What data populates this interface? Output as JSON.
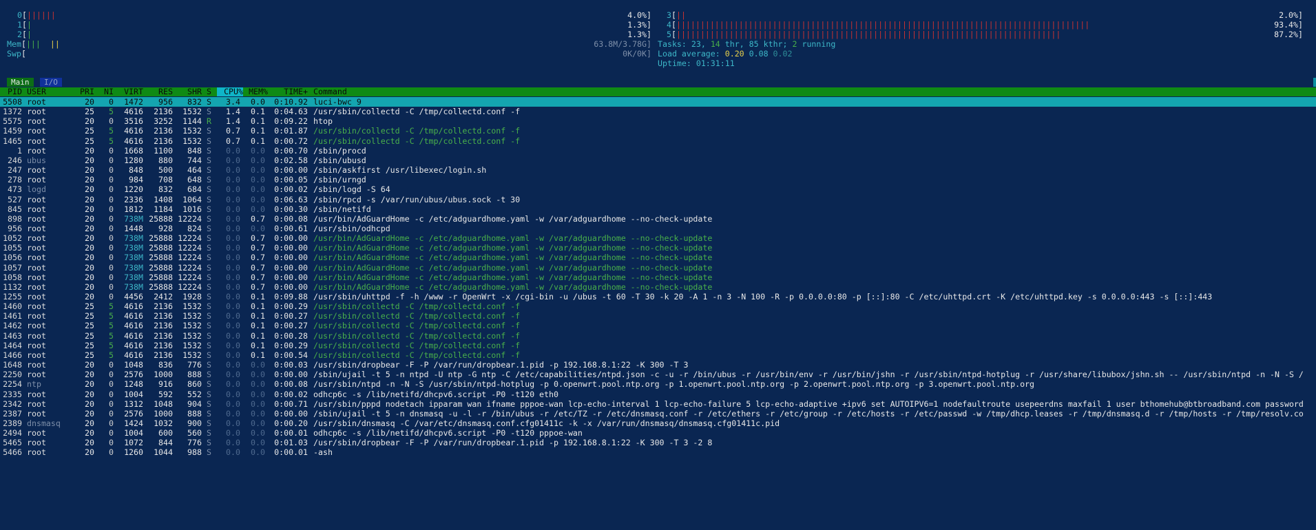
{
  "meters": {
    "cpu0": {
      "label": "0",
      "bars": "||||||",
      "pct": "4.0%]"
    },
    "cpu1": {
      "label": "1",
      "bars": "|",
      "pct": "1.3%]"
    },
    "cpu2": {
      "label": "2",
      "bars": "|",
      "pct": "1.3%]"
    },
    "cpu3": {
      "label": "3",
      "bars": "||",
      "pct": "2.0%]"
    },
    "cpu4": {
      "label": "4",
      "bars": "||||||||||||||||||||||||||||||||||||||||||||||||||||||||||||||||||||||||||||||||||||||",
      "pct": "93.4%]"
    },
    "cpu5": {
      "label": "5",
      "bars": "||||||||||||||||||||||||||||||||||||||||||||||||||||||||||||||||||||||||||||||||",
      "pct": "87.2%]"
    },
    "mem": {
      "label": "Mem",
      "bars": "|||",
      "bars2": "||",
      "value": "63.8M/3.78G]"
    },
    "swp": {
      "label": "Swp",
      "value": "0K/0K]"
    },
    "tasks": {
      "label": "Tasks: ",
      "n1": "23",
      "sep1": ", ",
      "n2": "14",
      "thr": " thr, ",
      "kthr": "85 kthr; ",
      "running": "2",
      "running_label": " running"
    },
    "load": {
      "label": "Load average: ",
      "l1": "0.20",
      "l5": "0.08",
      "l15": "0.02"
    },
    "uptime": {
      "label": "Uptime: ",
      "value": "01:31:11"
    }
  },
  "tabs": {
    "main": "Main",
    "io": "I/O"
  },
  "columns": {
    "pid": "PID",
    "user": "USER",
    "pri": "PRI",
    "ni": "NI",
    "virt": "VIRT",
    "res": "RES",
    "shr": "SHR",
    "s": "S",
    "cpu": "CPU%",
    "mem": "MEM%",
    "time": "TIME+",
    "cmd": "Command"
  },
  "processes": [
    {
      "pid": "5508",
      "user": "root",
      "pri": "20",
      "ni": "0",
      "virt": "1472",
      "res": "956",
      "shr": "832",
      "s": "S",
      "cpu": "3.4",
      "mem": "0.0",
      "time": "0:10.92",
      "cmd": "luci-bwc 9",
      "thread": false
    },
    {
      "pid": "1372",
      "user": "root",
      "pri": "25",
      "ni": "5",
      "virt": "4616",
      "res": "2136",
      "shr": "1532",
      "s": "S",
      "cpu": "1.4",
      "mem": "0.1",
      "time": "0:04.63",
      "cmd": "/usr/sbin/collectd -C /tmp/collectd.conf -f",
      "thread": false
    },
    {
      "pid": "5575",
      "user": "root",
      "pri": "20",
      "ni": "0",
      "virt": "3516",
      "res": "3252",
      "shr": "1144",
      "s": "R",
      "cpu": "1.4",
      "mem": "0.1",
      "time": "0:09.22",
      "cmd": "htop",
      "thread": false
    },
    {
      "pid": "1459",
      "user": "root",
      "pri": "25",
      "ni": "5",
      "virt": "4616",
      "res": "2136",
      "shr": "1532",
      "s": "S",
      "cpu": "0.7",
      "mem": "0.1",
      "time": "0:01.87",
      "cmd": "/usr/sbin/collectd -C /tmp/collectd.conf -f",
      "thread": true
    },
    {
      "pid": "1465",
      "user": "root",
      "pri": "25",
      "ni": "5",
      "virt": "4616",
      "res": "2136",
      "shr": "1532",
      "s": "S",
      "cpu": "0.7",
      "mem": "0.1",
      "time": "0:00.72",
      "cmd": "/usr/sbin/collectd -C /tmp/collectd.conf -f",
      "thread": true
    },
    {
      "pid": "1",
      "user": "root",
      "pri": "20",
      "ni": "0",
      "virt": "1668",
      "res": "1100",
      "shr": "848",
      "s": "S",
      "cpu": "0.0",
      "mem": "0.0",
      "time": "0:00.70",
      "cmd": "/sbin/procd",
      "thread": false
    },
    {
      "pid": "246",
      "user": "ubus",
      "pri": "20",
      "ni": "0",
      "virt": "1280",
      "res": "880",
      "shr": "744",
      "s": "S",
      "cpu": "0.0",
      "mem": "0.0",
      "time": "0:02.58",
      "cmd": "/sbin/ubusd",
      "thread": false
    },
    {
      "pid": "247",
      "user": "root",
      "pri": "20",
      "ni": "0",
      "virt": "848",
      "res": "500",
      "shr": "464",
      "s": "S",
      "cpu": "0.0",
      "mem": "0.0",
      "time": "0:00.00",
      "cmd": "/sbin/askfirst /usr/libexec/login.sh",
      "thread": false
    },
    {
      "pid": "278",
      "user": "root",
      "pri": "20",
      "ni": "0",
      "virt": "984",
      "res": "708",
      "shr": "648",
      "s": "S",
      "cpu": "0.0",
      "mem": "0.0",
      "time": "0:00.05",
      "cmd": "/sbin/urngd",
      "thread": false
    },
    {
      "pid": "473",
      "user": "logd",
      "pri": "20",
      "ni": "0",
      "virt": "1220",
      "res": "832",
      "shr": "684",
      "s": "S",
      "cpu": "0.0",
      "mem": "0.0",
      "time": "0:00.02",
      "cmd": "/sbin/logd -S 64",
      "thread": false
    },
    {
      "pid": "527",
      "user": "root",
      "pri": "20",
      "ni": "0",
      "virt": "2336",
      "res": "1408",
      "shr": "1064",
      "s": "S",
      "cpu": "0.0",
      "mem": "0.0",
      "time": "0:06.63",
      "cmd": "/sbin/rpcd -s /var/run/ubus/ubus.sock -t 30",
      "thread": false
    },
    {
      "pid": "845",
      "user": "root",
      "pri": "20",
      "ni": "0",
      "virt": "1812",
      "res": "1184",
      "shr": "1016",
      "s": "S",
      "cpu": "0.0",
      "mem": "0.0",
      "time": "0:00.30",
      "cmd": "/sbin/netifd",
      "thread": false
    },
    {
      "pid": "898",
      "user": "root",
      "pri": "20",
      "ni": "0",
      "virt": "738M",
      "res": "25888",
      "shr": "12224",
      "s": "S",
      "cpu": "0.0",
      "mem": "0.7",
      "time": "0:00.08",
      "cmd": "/usr/bin/AdGuardHome -c /etc/adguardhome.yaml -w /var/adguardhome --no-check-update",
      "thread": false
    },
    {
      "pid": "956",
      "user": "root",
      "pri": "20",
      "ni": "0",
      "virt": "1448",
      "res": "928",
      "shr": "824",
      "s": "S",
      "cpu": "0.0",
      "mem": "0.0",
      "time": "0:00.61",
      "cmd": "/usr/sbin/odhcpd",
      "thread": false
    },
    {
      "pid": "1052",
      "user": "root",
      "pri": "20",
      "ni": "0",
      "virt": "738M",
      "res": "25888",
      "shr": "12224",
      "s": "S",
      "cpu": "0.0",
      "mem": "0.7",
      "time": "0:00.00",
      "cmd": "/usr/bin/AdGuardHome -c /etc/adguardhome.yaml -w /var/adguardhome --no-check-update",
      "thread": true
    },
    {
      "pid": "1055",
      "user": "root",
      "pri": "20",
      "ni": "0",
      "virt": "738M",
      "res": "25888",
      "shr": "12224",
      "s": "S",
      "cpu": "0.0",
      "mem": "0.7",
      "time": "0:00.00",
      "cmd": "/usr/bin/AdGuardHome -c /etc/adguardhome.yaml -w /var/adguardhome --no-check-update",
      "thread": true
    },
    {
      "pid": "1056",
      "user": "root",
      "pri": "20",
      "ni": "0",
      "virt": "738M",
      "res": "25888",
      "shr": "12224",
      "s": "S",
      "cpu": "0.0",
      "mem": "0.7",
      "time": "0:00.00",
      "cmd": "/usr/bin/AdGuardHome -c /etc/adguardhome.yaml -w /var/adguardhome --no-check-update",
      "thread": true
    },
    {
      "pid": "1057",
      "user": "root",
      "pri": "20",
      "ni": "0",
      "virt": "738M",
      "res": "25888",
      "shr": "12224",
      "s": "S",
      "cpu": "0.0",
      "mem": "0.7",
      "time": "0:00.00",
      "cmd": "/usr/bin/AdGuardHome -c /etc/adguardhome.yaml -w /var/adguardhome --no-check-update",
      "thread": true
    },
    {
      "pid": "1058",
      "user": "root",
      "pri": "20",
      "ni": "0",
      "virt": "738M",
      "res": "25888",
      "shr": "12224",
      "s": "S",
      "cpu": "0.0",
      "mem": "0.7",
      "time": "0:00.00",
      "cmd": "/usr/bin/AdGuardHome -c /etc/adguardhome.yaml -w /var/adguardhome --no-check-update",
      "thread": true
    },
    {
      "pid": "1132",
      "user": "root",
      "pri": "20",
      "ni": "0",
      "virt": "738M",
      "res": "25888",
      "shr": "12224",
      "s": "S",
      "cpu": "0.0",
      "mem": "0.7",
      "time": "0:00.00",
      "cmd": "/usr/bin/AdGuardHome -c /etc/adguardhome.yaml -w /var/adguardhome --no-check-update",
      "thread": true
    },
    {
      "pid": "1255",
      "user": "root",
      "pri": "20",
      "ni": "0",
      "virt": "4456",
      "res": "2412",
      "shr": "1928",
      "s": "S",
      "cpu": "0.0",
      "mem": "0.1",
      "time": "0:09.88",
      "cmd": "/usr/sbin/uhttpd -f -h /www -r OpenWrt -x /cgi-bin -u /ubus -t 60 -T 30 -k 20 -A 1 -n 3 -N 100 -R -p 0.0.0.0:80 -p [::]:80 -C /etc/uhttpd.crt -K /etc/uhttpd.key -s 0.0.0.0:443 -s [::]:443",
      "thread": false
    },
    {
      "pid": "1460",
      "user": "root",
      "pri": "25",
      "ni": "5",
      "virt": "4616",
      "res": "2136",
      "shr": "1532",
      "s": "S",
      "cpu": "0.0",
      "mem": "0.1",
      "time": "0:00.29",
      "cmd": "/usr/sbin/collectd -C /tmp/collectd.conf -f",
      "thread": true
    },
    {
      "pid": "1461",
      "user": "root",
      "pri": "25",
      "ni": "5",
      "virt": "4616",
      "res": "2136",
      "shr": "1532",
      "s": "S",
      "cpu": "0.0",
      "mem": "0.1",
      "time": "0:00.27",
      "cmd": "/usr/sbin/collectd -C /tmp/collectd.conf -f",
      "thread": true
    },
    {
      "pid": "1462",
      "user": "root",
      "pri": "25",
      "ni": "5",
      "virt": "4616",
      "res": "2136",
      "shr": "1532",
      "s": "S",
      "cpu": "0.0",
      "mem": "0.1",
      "time": "0:00.27",
      "cmd": "/usr/sbin/collectd -C /tmp/collectd.conf -f",
      "thread": true
    },
    {
      "pid": "1463",
      "user": "root",
      "pri": "25",
      "ni": "5",
      "virt": "4616",
      "res": "2136",
      "shr": "1532",
      "s": "S",
      "cpu": "0.0",
      "mem": "0.1",
      "time": "0:00.28",
      "cmd": "/usr/sbin/collectd -C /tmp/collectd.conf -f",
      "thread": true
    },
    {
      "pid": "1464",
      "user": "root",
      "pri": "25",
      "ni": "5",
      "virt": "4616",
      "res": "2136",
      "shr": "1532",
      "s": "S",
      "cpu": "0.0",
      "mem": "0.1",
      "time": "0:00.29",
      "cmd": "/usr/sbin/collectd -C /tmp/collectd.conf -f",
      "thread": true
    },
    {
      "pid": "1466",
      "user": "root",
      "pri": "25",
      "ni": "5",
      "virt": "4616",
      "res": "2136",
      "shr": "1532",
      "s": "S",
      "cpu": "0.0",
      "mem": "0.1",
      "time": "0:00.54",
      "cmd": "/usr/sbin/collectd -C /tmp/collectd.conf -f",
      "thread": true
    },
    {
      "pid": "1648",
      "user": "root",
      "pri": "20",
      "ni": "0",
      "virt": "1048",
      "res": "836",
      "shr": "776",
      "s": "S",
      "cpu": "0.0",
      "mem": "0.0",
      "time": "0:00.03",
      "cmd": "/usr/sbin/dropbear -F -P /var/run/dropbear.1.pid -p 192.168.8.1:22 -K 300 -T 3",
      "thread": false
    },
    {
      "pid": "2250",
      "user": "root",
      "pri": "20",
      "ni": "0",
      "virt": "2576",
      "res": "1000",
      "shr": "888",
      "s": "S",
      "cpu": "0.0",
      "mem": "0.0",
      "time": "0:00.00",
      "cmd": "/sbin/ujail -t 5 -n ntpd -U ntp -G ntp -C /etc/capabilities/ntpd.json -c -u -r /bin/ubus -r /usr/bin/env -r /usr/bin/jshn -r /usr/sbin/ntpd-hotplug -r /usr/share/libubox/jshn.sh -- /usr/sbin/ntpd -n -N -S /",
      "thread": false
    },
    {
      "pid": "2254",
      "user": "ntp",
      "pri": "20",
      "ni": "0",
      "virt": "1248",
      "res": "916",
      "shr": "860",
      "s": "S",
      "cpu": "0.0",
      "mem": "0.0",
      "time": "0:00.08",
      "cmd": "/usr/sbin/ntpd -n -N -S /usr/sbin/ntpd-hotplug -p 0.openwrt.pool.ntp.org -p 1.openwrt.pool.ntp.org -p 2.openwrt.pool.ntp.org -p 3.openwrt.pool.ntp.org",
      "thread": false
    },
    {
      "pid": "2335",
      "user": "root",
      "pri": "20",
      "ni": "0",
      "virt": "1004",
      "res": "592",
      "shr": "552",
      "s": "S",
      "cpu": "0.0",
      "mem": "0.0",
      "time": "0:00.02",
      "cmd": "odhcp6c -s /lib/netifd/dhcpv6.script -P0 -t120 eth0",
      "thread": false
    },
    {
      "pid": "2342",
      "user": "root",
      "pri": "20",
      "ni": "0",
      "virt": "1312",
      "res": "1048",
      "shr": "904",
      "s": "S",
      "cpu": "0.0",
      "mem": "0.0",
      "time": "0:00.71",
      "cmd": "/usr/sbin/pppd nodetach ipparam wan ifname pppoe-wan lcp-echo-interval 1 lcp-echo-failure 5 lcp-echo-adaptive +ipv6 set AUTOIPV6=1 nodefaultroute usepeerdns maxfail 1 user bthomehub@btbroadband.com password",
      "thread": false
    },
    {
      "pid": "2387",
      "user": "root",
      "pri": "20",
      "ni": "0",
      "virt": "2576",
      "res": "1000",
      "shr": "888",
      "s": "S",
      "cpu": "0.0",
      "mem": "0.0",
      "time": "0:00.00",
      "cmd": "/sbin/ujail -t 5 -n dnsmasq -u -l -r /bin/ubus -r /etc/TZ -r /etc/dnsmasq.conf -r /etc/ethers -r /etc/group -r /etc/hosts -r /etc/passwd -w /tmp/dhcp.leases -r /tmp/dnsmasq.d -r /tmp/hosts -r /tmp/resolv.co",
      "thread": false
    },
    {
      "pid": "2389",
      "user": "dnsmasq",
      "pri": "20",
      "ni": "0",
      "virt": "1424",
      "res": "1032",
      "shr": "900",
      "s": "S",
      "cpu": "0.0",
      "mem": "0.0",
      "time": "0:00.20",
      "cmd": "/usr/sbin/dnsmasq -C /var/etc/dnsmasq.conf.cfg01411c -k -x /var/run/dnsmasq/dnsmasq.cfg01411c.pid",
      "thread": false
    },
    {
      "pid": "2494",
      "user": "root",
      "pri": "20",
      "ni": "0",
      "virt": "1004",
      "res": "600",
      "shr": "560",
      "s": "S",
      "cpu": "0.0",
      "mem": "0.0",
      "time": "0:00.01",
      "cmd": "odhcp6c -s /lib/netifd/dhcpv6.script -P0 -t120 pppoe-wan",
      "thread": false
    },
    {
      "pid": "5465",
      "user": "root",
      "pri": "20",
      "ni": "0",
      "virt": "1072",
      "res": "844",
      "shr": "776",
      "s": "S",
      "cpu": "0.0",
      "mem": "0.0",
      "time": "0:01.03",
      "cmd": "/usr/sbin/dropbear -F -P /var/run/dropbear.1.pid -p 192.168.8.1:22 -K 300 -T 3 -2 8",
      "thread": false
    },
    {
      "pid": "5466",
      "user": "root",
      "pri": "20",
      "ni": "0",
      "virt": "1260",
      "res": "1044",
      "shr": "988",
      "s": "S",
      "cpu": "0.0",
      "mem": "0.0",
      "time": "0:00.01",
      "cmd": "-ash",
      "thread": false
    }
  ]
}
